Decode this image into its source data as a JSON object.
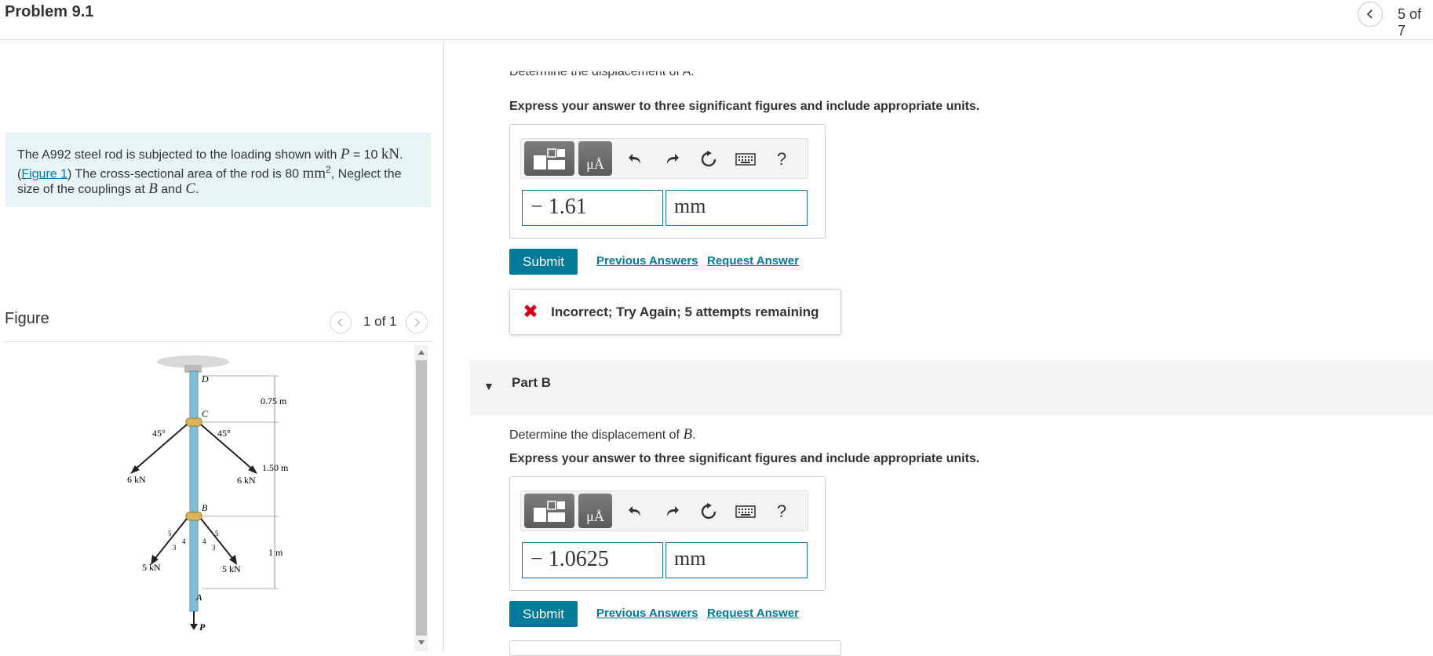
{
  "header": {
    "title": "Problem 9.1",
    "nav_count": "5 of 7"
  },
  "problem": {
    "text_1": "The A992 steel rod is subjected to the loading shown with ",
    "var_P": "P",
    "text_2": " = 10 ",
    "unit_kN": "kN",
    "text_3": ".",
    "figure_link": "Figure 1",
    "text_4": ") The cross-sectional area of the rod is 80 ",
    "unit_mm": "mm",
    "sup_2": "2",
    "text_5": ",  Neglect the size of the couplings at ",
    "var_B": "B",
    "text_6": " and ",
    "var_C": "C",
    "text_7": "."
  },
  "figure": {
    "title": "Figure",
    "count": "1 of 1",
    "labels": {
      "D": "D",
      "C": "C",
      "B": "B",
      "A": "A",
      "P": "P",
      "dim1": "0.75 m",
      "dim2": "1.50 m",
      "dim3": "1 m",
      "angle_left": "45°",
      "angle_right": "45°",
      "force_6kN_left": "6 kN",
      "force_6kN_right": "6 kN",
      "force_5kN_left": "5 kN",
      "force_5kN_right": "5 kN",
      "tri_5": "5",
      "tri_4": "4",
      "tri_3": "3"
    }
  },
  "partA": {
    "prompt_cut": "Determine the displacement of A.",
    "instruction": "Express your answer to three significant figures and include appropriate units.",
    "value": "− 1.61",
    "unit": "mm",
    "submit": "Submit",
    "previous_answers": "Previous Answers",
    "request_answer": "Request Answer",
    "feedback": "Incorrect; Try Again; 5 attempts remaining"
  },
  "toolbar": {
    "mu_symbol": "μÅ",
    "help": "?"
  },
  "partB": {
    "label": "Part B",
    "prompt_prefix": "Determine the displacement of ",
    "prompt_var": "B",
    "prompt_suffix": ".",
    "instruction": "Express your answer to three significant figures and include appropriate units.",
    "value": "− 1.0625",
    "unit": "mm",
    "submit": "Submit",
    "previous_answers": "Previous Answers",
    "request_answer": "Request Answer"
  },
  "colors": {
    "accent": "#007a99",
    "statement_bg": "#e7f5f6",
    "error": "#d0021b",
    "rod": "#7fbcd6",
    "coupling": "#d8b45a"
  }
}
